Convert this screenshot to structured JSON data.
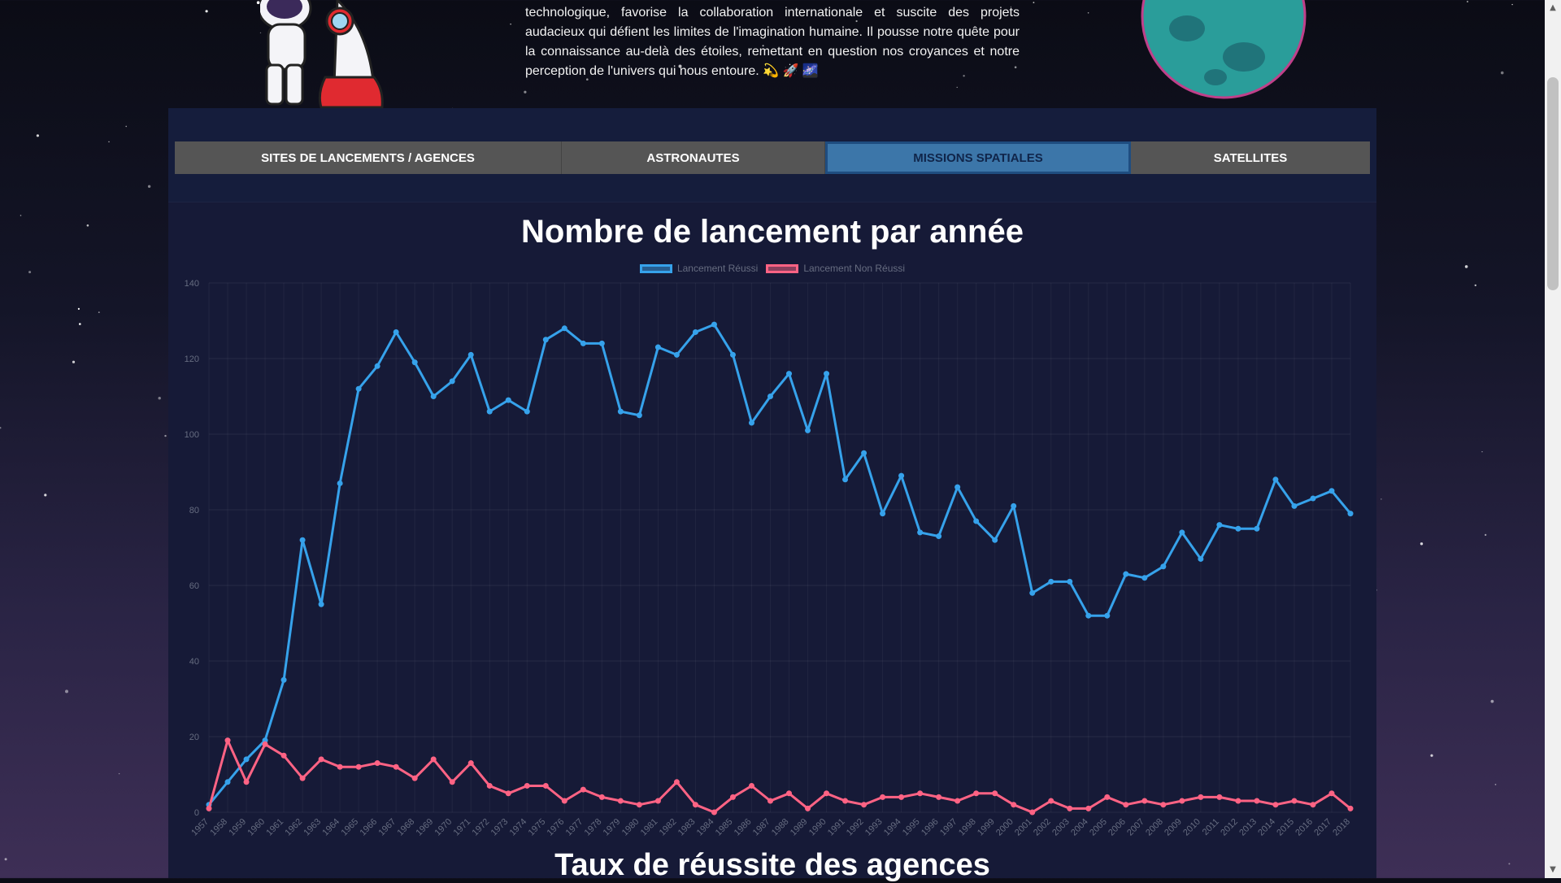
{
  "intro_text": "technologique, favorise la collaboration internationale et suscite des projets audacieux qui défient les limites de l'imagination humaine. Il pousse notre quête pour la connaissance au-delà des étoiles, remettant en question nos croyances et notre perception de l'univers qui nous entoure. 💫 🚀 🌌",
  "tabs": [
    {
      "label": "SITES DE LANCEMENTS / AGENCES",
      "active": false
    },
    {
      "label": "ASTRONAUTES",
      "active": false
    },
    {
      "label": "MISSIONS SPATIALES",
      "active": true
    },
    {
      "label": "SATELLITES",
      "active": false
    }
  ],
  "colors": {
    "success": "#36a2eb",
    "failure": "#ff6384",
    "tab_active_bg": "#3c76a9",
    "tab_bg": "#555555",
    "panel_bg": "#161a37"
  },
  "chart_data": {
    "type": "line",
    "title": "Nombre de lancement par année",
    "xlabel": "",
    "ylabel": "",
    "ylim": [
      0,
      140
    ],
    "yticks": [
      0,
      20,
      40,
      60,
      80,
      100,
      120,
      140
    ],
    "grid": true,
    "legend_position": "top",
    "categories": [
      "1957",
      "1958",
      "1959",
      "1960",
      "1961",
      "1962",
      "1963",
      "1964",
      "1965",
      "1966",
      "1967",
      "1968",
      "1969",
      "1970",
      "1971",
      "1972",
      "1973",
      "1974",
      "1975",
      "1976",
      "1977",
      "1978",
      "1979",
      "1980",
      "1981",
      "1982",
      "1983",
      "1984",
      "1985",
      "1986",
      "1987",
      "1988",
      "1989",
      "1990",
      "1991",
      "1992",
      "1993",
      "1994",
      "1995",
      "1996",
      "1997",
      "1998",
      "1999",
      "2000",
      "2001",
      "2002",
      "2003",
      "2004",
      "2005",
      "2006",
      "2007",
      "2008",
      "2009",
      "2010",
      "2011",
      "2012",
      "2013",
      "2014",
      "2015",
      "2016",
      "2017",
      "2018"
    ],
    "series": [
      {
        "name": "Lancement Réussi",
        "color": "#36a2eb",
        "values": [
          2,
          8,
          14,
          19,
          35,
          72,
          55,
          87,
          112,
          118,
          127,
          119,
          110,
          114,
          121,
          106,
          109,
          106,
          125,
          128,
          124,
          124,
          106,
          105,
          123,
          121,
          127,
          129,
          121,
          103,
          110,
          116,
          101,
          116,
          88,
          95,
          79,
          89,
          74,
          73,
          86,
          77,
          72,
          81,
          58,
          61,
          61,
          52,
          52,
          63,
          62,
          65,
          74,
          67,
          76,
          75,
          75,
          88,
          81,
          83,
          85,
          79
        ]
      },
      {
        "name": "Lancement Non Réussi",
        "color": "#ff6384",
        "values": [
          1,
          19,
          8,
          18,
          15,
          9,
          14,
          12,
          12,
          13,
          12,
          9,
          14,
          8,
          13,
          7,
          5,
          7,
          7,
          3,
          6,
          4,
          3,
          2,
          3,
          8,
          2,
          0,
          4,
          7,
          3,
          5,
          1,
          5,
          3,
          2,
          4,
          4,
          5,
          4,
          3,
          5,
          5,
          2,
          0,
          3,
          1,
          1,
          4,
          2,
          3,
          2,
          3,
          4,
          4,
          3,
          3,
          2,
          3,
          2,
          5,
          1
        ]
      }
    ]
  },
  "next_section_title": "Taux de réussite des agences"
}
